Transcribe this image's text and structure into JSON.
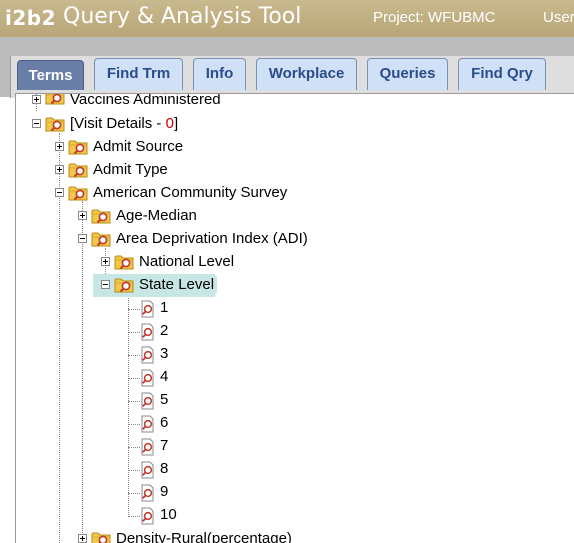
{
  "header": {
    "logo": "i2b2",
    "title": "Query & Analysis Tool",
    "project": "Project: WFUBMC",
    "user": "User"
  },
  "tabs": [
    {
      "label": "Terms",
      "active": true
    },
    {
      "label": "Find Trm",
      "active": false
    },
    {
      "label": "Info",
      "active": false
    },
    {
      "label": "Workplace",
      "active": false
    },
    {
      "label": "Queries",
      "active": false
    },
    {
      "label": "Find Qry",
      "active": false
    }
  ],
  "tree": {
    "vaccines": "Vaccines Administered",
    "visit_details_prefix": "[Visit Details - ",
    "visit_details_count": "0",
    "visit_details_suffix": "]",
    "admit_source": "Admit Source",
    "admit_type": "Admit Type",
    "acs": "American Community Survey",
    "age_median": "Age-Median",
    "adi": "Area Deprivation Index (ADI)",
    "national": "National Level",
    "state": "State Level",
    "leaves": [
      "1",
      "2",
      "3",
      "4",
      "5",
      "6",
      "7",
      "8",
      "9",
      "10"
    ],
    "density": "Density-Rural(percentage)"
  },
  "colors": {
    "header": "#c1b085",
    "active_tab": "#6a7fa8",
    "inactive_tab": "#cfe0f7",
    "selection": "#c7e7e5",
    "count": "#cc0000"
  },
  "icons": {
    "folder": "folder-search-icon",
    "leaf": "leaf-search-icon",
    "expand": "expand-icon",
    "collapse": "collapse-icon"
  }
}
